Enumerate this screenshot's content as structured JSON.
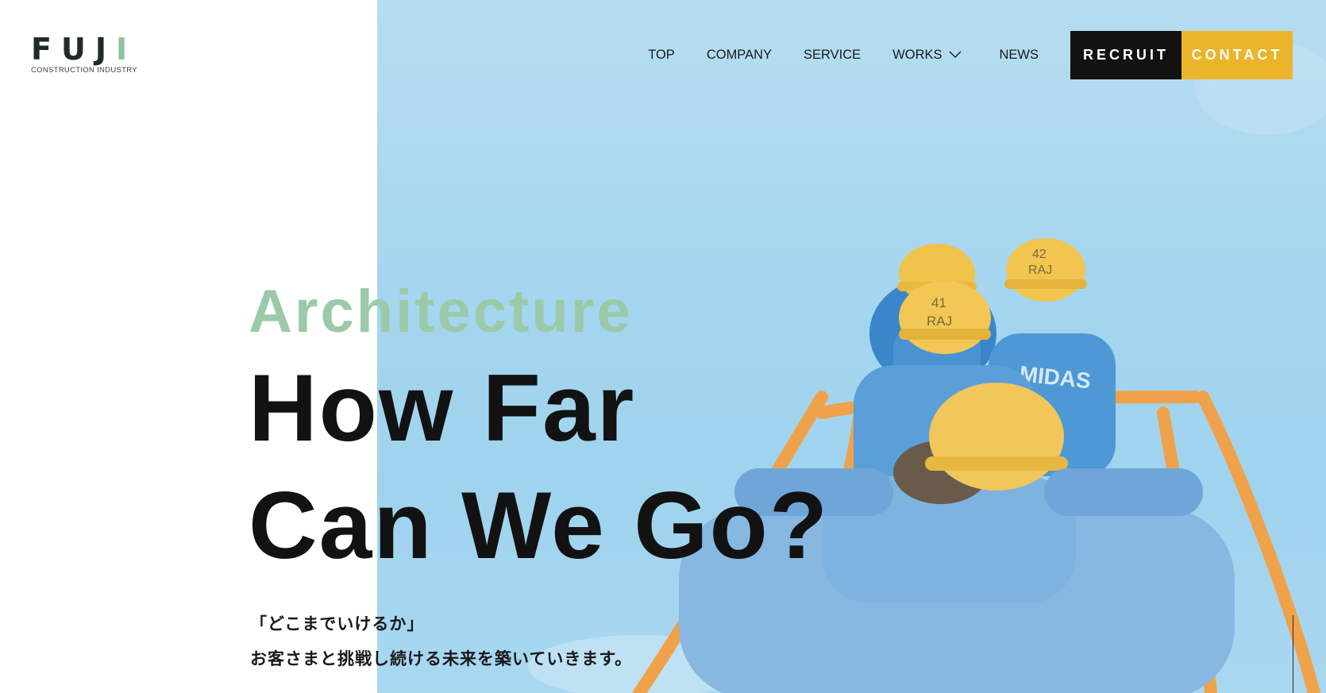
{
  "logo": {
    "mark_main": "FUJ",
    "mark_accent": "I",
    "subtitle": "CONSTRUCTION INDUSTRY"
  },
  "nav": {
    "items": [
      {
        "label": "TOP"
      },
      {
        "label": "COMPANY"
      },
      {
        "label": "SERVICE"
      },
      {
        "label": "WORKS"
      },
      {
        "label": "NEWS"
      }
    ],
    "recruit_label": "RECRUIT",
    "contact_label": "CONTACT"
  },
  "hero": {
    "eyebrow": "Architecture",
    "headline_line1": "How Far",
    "headline_line2": "Can We Go?",
    "tagline_line1": "「どこまでいけるか」",
    "tagline_line2": "お客さまと挑戦し続ける未来を築いていきます。"
  },
  "colors": {
    "accent_green": "#9ccaa8",
    "contact_yellow": "#ecb42a",
    "recruit_black": "#121212",
    "sky_blue": "#a6d6ef"
  },
  "icons": {
    "works_dropdown": "chevron-down-icon"
  }
}
